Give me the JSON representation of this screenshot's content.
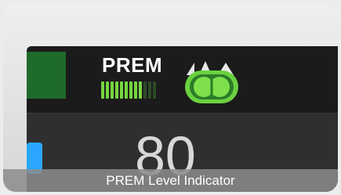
{
  "panel": {
    "mode_label": "PREM",
    "level": {
      "filled": 9,
      "total": 12
    },
    "reading_value": "80",
    "colors": {
      "screen": "#1b1b1b",
      "indicator_green": "#76d63f",
      "indicator_off": "#2d4a27",
      "accent_blue": "#2aa6ff"
    }
  },
  "caption": {
    "text": "PREM Level Indicator"
  },
  "icons": {
    "lungs": "lungs-icon"
  }
}
